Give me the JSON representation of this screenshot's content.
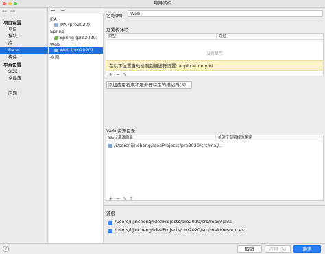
{
  "window": {
    "title": "项目结构"
  },
  "nav": {
    "back": "←",
    "forward": "→",
    "project_settings": "项目设置",
    "items_project": [
      "项目",
      "模块",
      "库",
      "Facet",
      "构件"
    ],
    "platform_settings": "平台设置",
    "items_platform": [
      "SDK",
      "全局库"
    ],
    "problems": "问题"
  },
  "facets": {
    "add": "+",
    "remove": "−",
    "groups": [
      {
        "label": "JPA",
        "child": "JPA (pro2020)"
      },
      {
        "label": "Spring",
        "child": "Spring (pro2020)"
      },
      {
        "label": "Web",
        "child": "Web (pro2020)"
      }
    ],
    "detection": "检测"
  },
  "detail": {
    "name_label": "名称(M):",
    "name_value": "Web",
    "descriptors_title": "部署描述符",
    "descriptors_cols": [
      "类型",
      "路径"
    ],
    "descriptors_empty": "没有显示",
    "warning": "在以下位置自动检测到描述符设置: application.yml",
    "add_descriptor_btn": "添加应用程序和服务器特定的描述符(S)...",
    "webres_title": "Web 资源目录",
    "webres_cols": [
      "Web 资源目录",
      "相对于部署根的路径"
    ],
    "webres_rows": [
      {
        "dir": "/Users/lijincheng/IdeaProjects/pro2020/src/mai...",
        "path": "/"
      }
    ],
    "sources_title": "源根",
    "sources": [
      "/Users/lijincheng/IdeaProjects/pro2020/src/main/java",
      "/Users/lijincheng/IdeaProjects/pro2020/src/main/resources"
    ]
  },
  "footer": {
    "help": "?",
    "cancel": "取消",
    "apply": "应用 (A)",
    "ok": "确定"
  }
}
